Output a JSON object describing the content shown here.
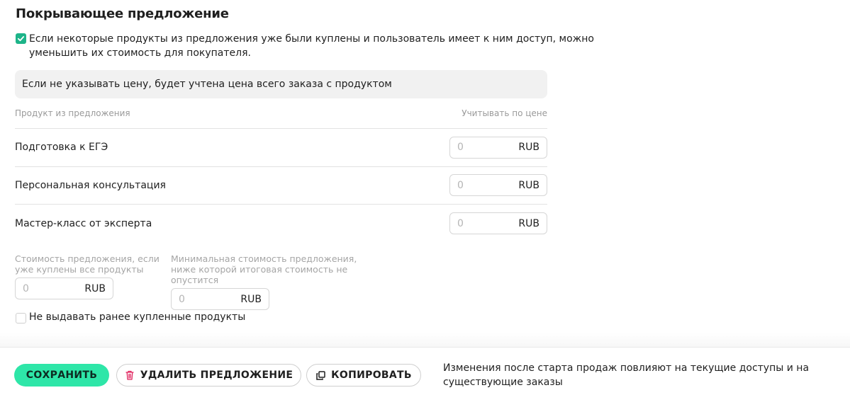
{
  "section": {
    "title": "Покрывающее предложение",
    "reduce_checkbox_label": "Если некоторые продукты из предложения уже были куплены и пользователь имеет к ним доступ, можно уменьшить их стоимость для покупателя.",
    "reduce_checked": true,
    "info": "Если не указывать цену, будет учтена цена всего заказа с продуктом"
  },
  "table": {
    "col_product": "Продукт из предложения",
    "col_price": "Учитывать по цене",
    "rows": [
      {
        "name": "Подготовка к ЕГЭ",
        "price_placeholder": "0",
        "currency": "RUB"
      },
      {
        "name": "Персональная консультация",
        "price_placeholder": "0",
        "currency": "RUB"
      },
      {
        "name": "Мастер-класс от эксперта",
        "price_placeholder": "0",
        "currency": "RUB"
      }
    ]
  },
  "costs": {
    "all_bought_label": "Стоимость предложения, если уже куплены все продукты",
    "all_bought_placeholder": "0",
    "all_bought_currency": "RUB",
    "min_label": "Минимальная стоимость предложения, ниже которой итоговая стоимость не опустится",
    "min_placeholder": "0",
    "min_currency": "RUB"
  },
  "no_give_checkbox_label": "Не выдавать ранее купленные продукты",
  "no_give_checked": false,
  "footer": {
    "save_label": "СОХРАНИТЬ",
    "delete_label": "УДАЛИТЬ ПРЕДЛОЖЕНИЕ",
    "copy_label": "КОПИРОВАТЬ",
    "note": "Изменения после старта продаж повлияют на текущие доступы и на существующие заказы"
  },
  "colors": {
    "accent": "#2ee6a8",
    "check": "#1db489",
    "delete_icon": "#e0245e"
  },
  "icons": {
    "check": "check-icon",
    "delete": "trash-icon",
    "copy": "copy-icon"
  }
}
